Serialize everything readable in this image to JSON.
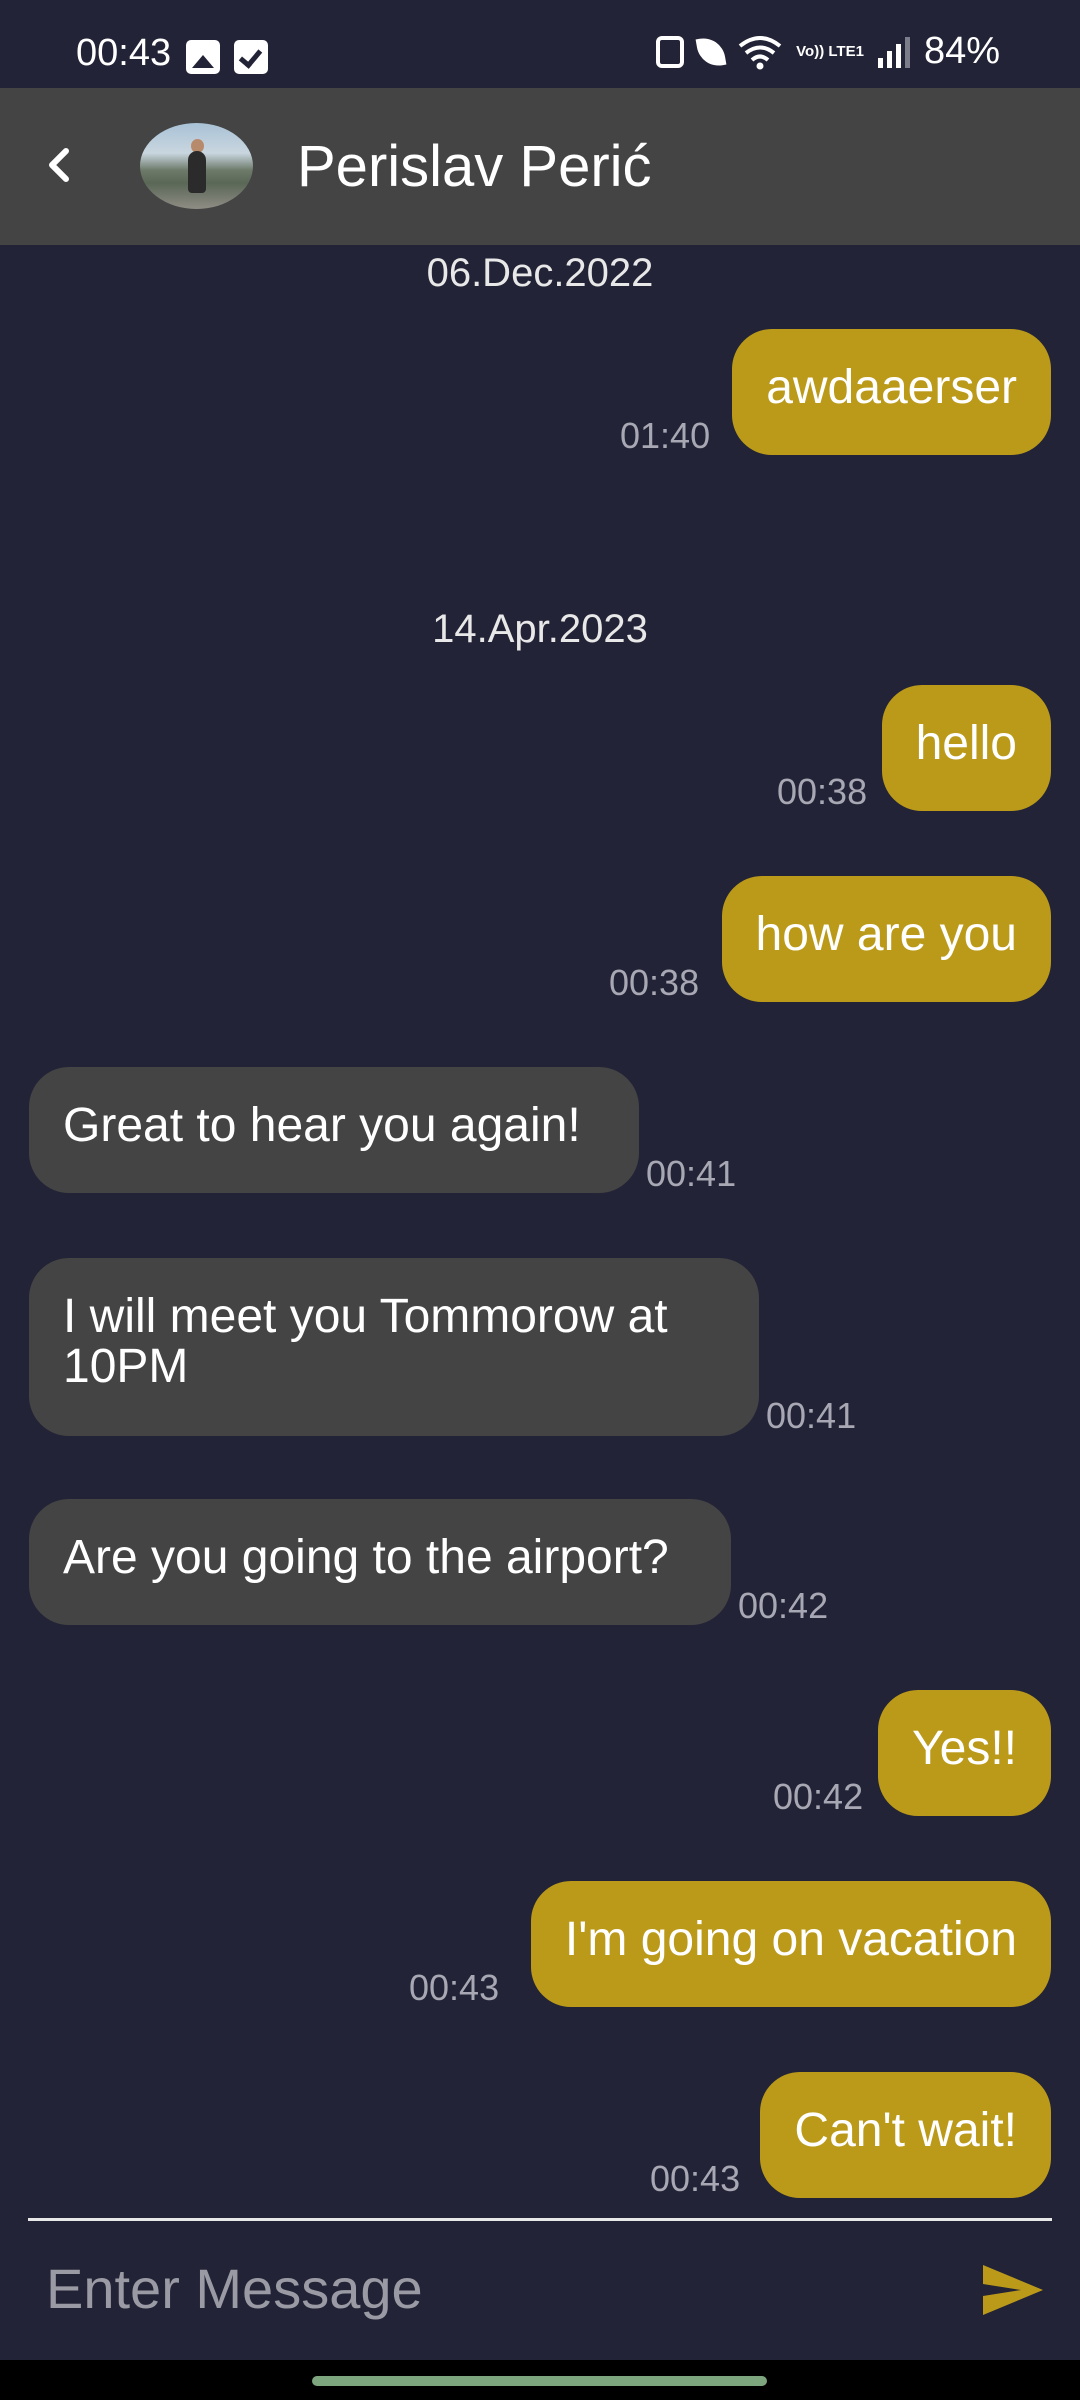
{
  "status_bar": {
    "time": "00:43",
    "battery": "84%",
    "left_icons": [
      "image-icon",
      "checkbox-icon"
    ],
    "right_icons": [
      "battery-saver-icon",
      "leaf-icon",
      "wifi-icon",
      "volte-icon",
      "signal-icon"
    ],
    "volte_text": "Vo)) LTE1"
  },
  "header": {
    "contact_name": "Perislav Perić",
    "back_icon": "chevron-left-icon"
  },
  "messages": {
    "date1": "06.Dec.2022",
    "date2": "14.Apr.2023",
    "items": [
      {
        "text": "awdaaerser",
        "time": "01:40",
        "direction": "sent"
      },
      {
        "text": "hello",
        "time": "00:38",
        "direction": "sent"
      },
      {
        "text": "how are you",
        "time": "00:38",
        "direction": "sent"
      },
      {
        "text": "Great to hear you again!",
        "time": "00:41",
        "direction": "received"
      },
      {
        "text": "I will meet you Tommorow at 10PM",
        "time": "00:41",
        "direction": "received"
      },
      {
        "text": "Are you going to the airport?",
        "time": "00:42",
        "direction": "received"
      },
      {
        "text": "Yes!!",
        "time": "00:42",
        "direction": "sent"
      },
      {
        "text": "I'm going on vacation",
        "time": "00:43",
        "direction": "sent"
      },
      {
        "text": "Can't wait!",
        "time": "00:43",
        "direction": "sent"
      }
    ]
  },
  "input": {
    "placeholder": "Enter Message",
    "send_icon": "send-icon"
  },
  "colors": {
    "background": "#222336",
    "header": "#444444",
    "sent_bubble": "#bb9a1a",
    "received_bubble": "#444444",
    "timestamp": "#a8a8b4",
    "send_accent": "#bb9a1a"
  }
}
